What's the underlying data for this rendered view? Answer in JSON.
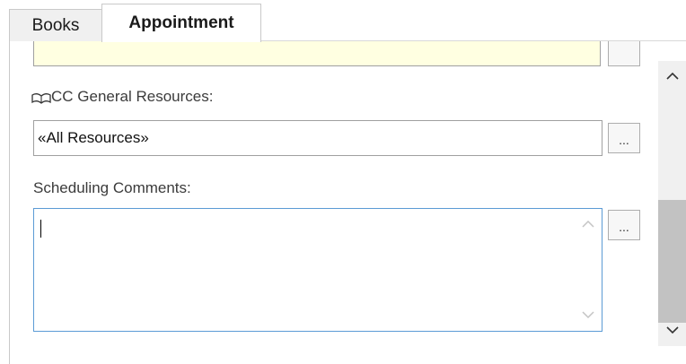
{
  "tabs": [
    {
      "label": "Books",
      "active": false
    },
    {
      "label": "Appointment",
      "active": true
    }
  ],
  "form": {
    "resources_label": "CC General Resources:",
    "resources_icon": "book-icon",
    "resources_value": "«All Resources»",
    "comments_label": "Scheduling Comments:",
    "comments_value": "",
    "ellipsis_label": "...",
    "highlight_color": "#ffffe1",
    "focus_color": "#5b9bd5"
  },
  "scroll": {
    "inner_scroll_position": 0,
    "outer_scroll_position": 1.0
  }
}
